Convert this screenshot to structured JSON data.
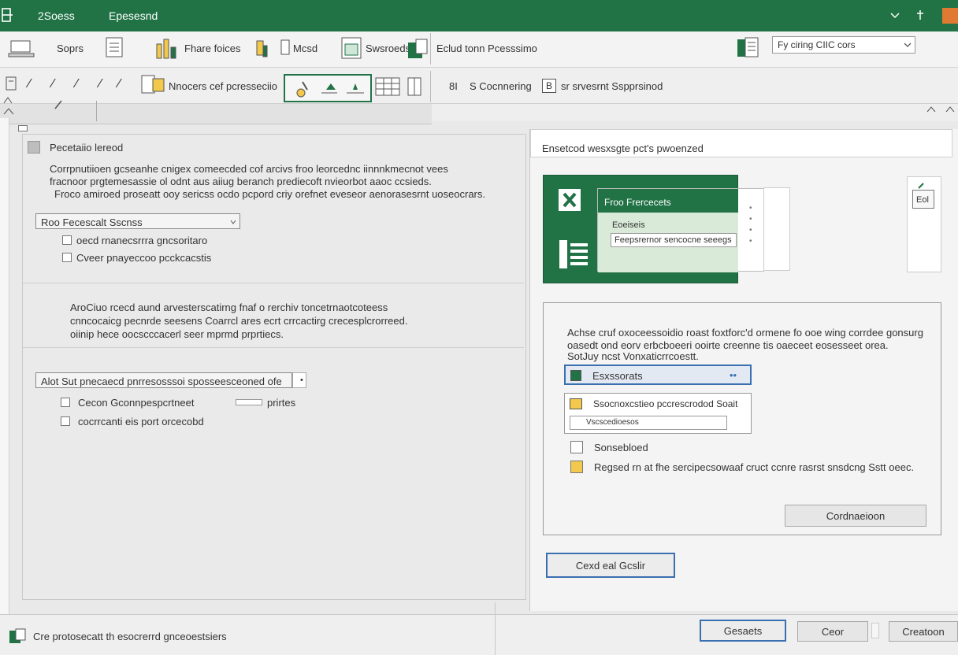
{
  "titlebar": {
    "tab1": "2Soess",
    "tab2": "Epesesnd",
    "accent": "#217346"
  },
  "ribbon1": {
    "items": [
      "Soprs",
      "Fhare foices",
      "Mcsd",
      "Swsroeds",
      "Eclud tonn Pcesssimo"
    ],
    "search_value": "Fy ciring CIIC cors"
  },
  "ribbon2": {
    "group_label": "Nnocers cef pcresseciio",
    "font_size": "8I",
    "font_label": "S Cocnnering",
    "fill_label": "B",
    "style_label": "sr srvesrnt Sspprsinod"
  },
  "left_panel": {
    "section1_title": "Pecetaiio lereod",
    "section1_desc": [
      "Corrpnutiioen gcseanhe cnigex comeecded cof arcivs froo leorcednc iinnnkmecnot vees",
      "fracnoor prgtemesassie ol odnt aus aiiug beranch prediecoft nvieorbot aaoc ccsieds.",
      "Froco amiroed proseatt ooy sericss ocdo pcpord criy orefnet eveseor aenorasesrnt uoseocrars."
    ],
    "dropdown1_value": "Roo Fecescalt Sscnss",
    "check1": "oecd rnanecsrrra gncsoritaro",
    "check2": "Cveer pnayeccoo pcckcacstis",
    "section2_desc": [
      "AroCiuo rcecd aund arvesterscatirng fnaf o rerchiv toncetrnaotcoteess",
      "cnncocaicg pecnrde seesens Coarrcl ares ecrt crrcactirg crecesplcrorreed.",
      "oiinip hece oocscccacerl seer mprmd prprtiecs."
    ],
    "dropdown2_value": "Alot Sut pnecaecd pnrresosssoi sposseesceoned ofe",
    "check3": "Cecon Gconnpespcrtneet",
    "check3_side": "prirtes",
    "check4": "cocrrcanti eis port orcecobd"
  },
  "right_panel": {
    "header": "Ensetcod wesxsgte pct's pwoenzed",
    "preview": {
      "card_title": "Froo Frercecets",
      "item1": "Eoeiseis",
      "item2": "Feepsrernor sencocne seeegs",
      "side_value": "Eol"
    },
    "desc": [
      "Achse cruf oxoceessoidio roast foxtforc'd ormene fo ooe wing corrdee gonsurg",
      "oasedt ond eorv erbcboeeri ooirte creenne tis oaeceet eosesseet orea.",
      "SotJuy ncst Vonxaticrrcoestt."
    ],
    "field1": "Esxssorats",
    "field2": "Ssocnoxcstieo pccrescrodod Soait",
    "field2_sub": "Vscscedioesos",
    "option1": "Sonsebloed",
    "option2": "Regsed rn at fhe sercipecsowaaf cruct ccnre rasrst snsdcng Sstt oeec.",
    "inner_button": "Cordnaeioon",
    "outer_button": "Cexd eal Gcslir"
  },
  "statusbar": {
    "text": "Cre protosecatt th esocrerrd gnceoestsiers",
    "buttons": [
      "Gesaets",
      "Ceor",
      "Creatoon"
    ]
  }
}
